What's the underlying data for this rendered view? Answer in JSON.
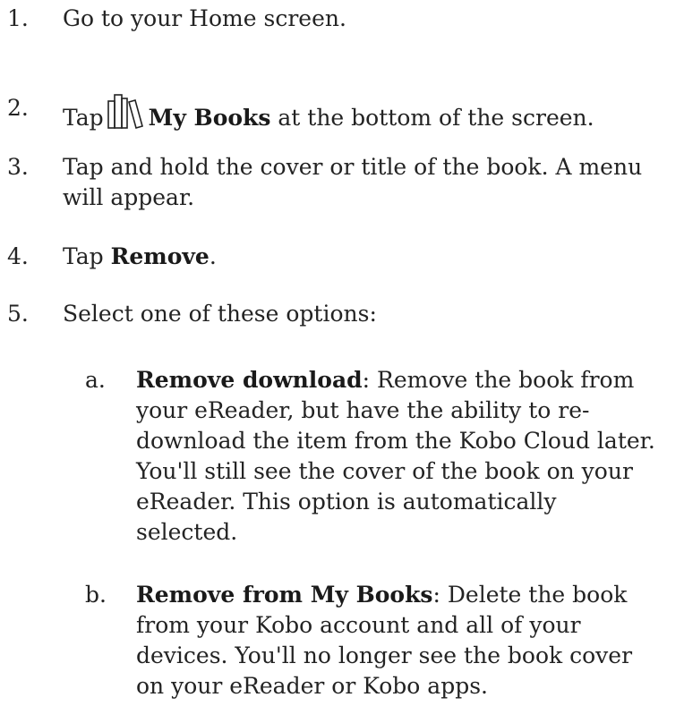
{
  "steps": [
    {
      "number": "1.",
      "text": "Go to your Home screen."
    },
    {
      "number": "2.",
      "before": "Tap",
      "icon": "my-books-icon",
      "bold": "My Books",
      "after": " at the bottom of the screen."
    },
    {
      "number": "3.",
      "text": "Tap and hold the cover or title of the book. A menu will appear."
    },
    {
      "number": "4.",
      "before": "Tap ",
      "bold": "Remove",
      "after": "."
    },
    {
      "number": "5.",
      "text": "Select one of these options:"
    }
  ],
  "options": [
    {
      "letter": "a.",
      "bold": "Remove download",
      "text": ": Remove the book from your eReader, but have the ability to re-download the item from the Kobo Cloud later. You'll still see the cover of the book on your eReader. This option is automatically selected."
    },
    {
      "letter": "b.",
      "bold": "Remove from My Books",
      "text": ": Delete the book from your Kobo account and all of your devices. You'll no longer see the book cover on your eReader or Kobo apps."
    }
  ]
}
